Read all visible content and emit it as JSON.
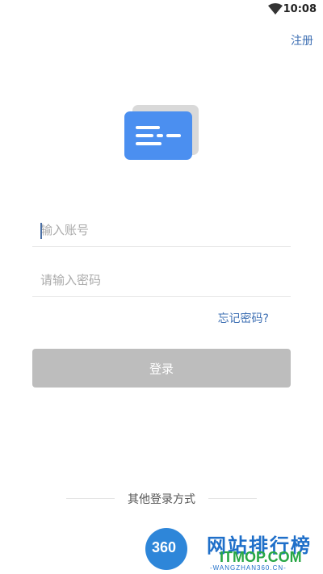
{
  "status_bar": {
    "time": "10:08",
    "wifi_icon": "wifi-icon"
  },
  "header": {
    "register_label": "注册"
  },
  "logo": {
    "icon": "message-card-logo-icon",
    "colors": {
      "front": "#4b8ff0",
      "back": "#d9d9d9",
      "lines": "#ffffff"
    }
  },
  "form": {
    "account_placeholder": "输入账号",
    "password_placeholder": "请输入密码",
    "forgot_label": "忘记密码?",
    "login_label": "登录"
  },
  "other_login": {
    "label": "其他登录方式"
  },
  "watermark": {
    "number": "360",
    "cn": "网站排行榜",
    "en": "ITMOP.COM",
    "url": "-WANGZHAN360.CN-"
  },
  "colors": {
    "link": "#3d6fb3",
    "button_disabled": "#bdbdbd"
  }
}
